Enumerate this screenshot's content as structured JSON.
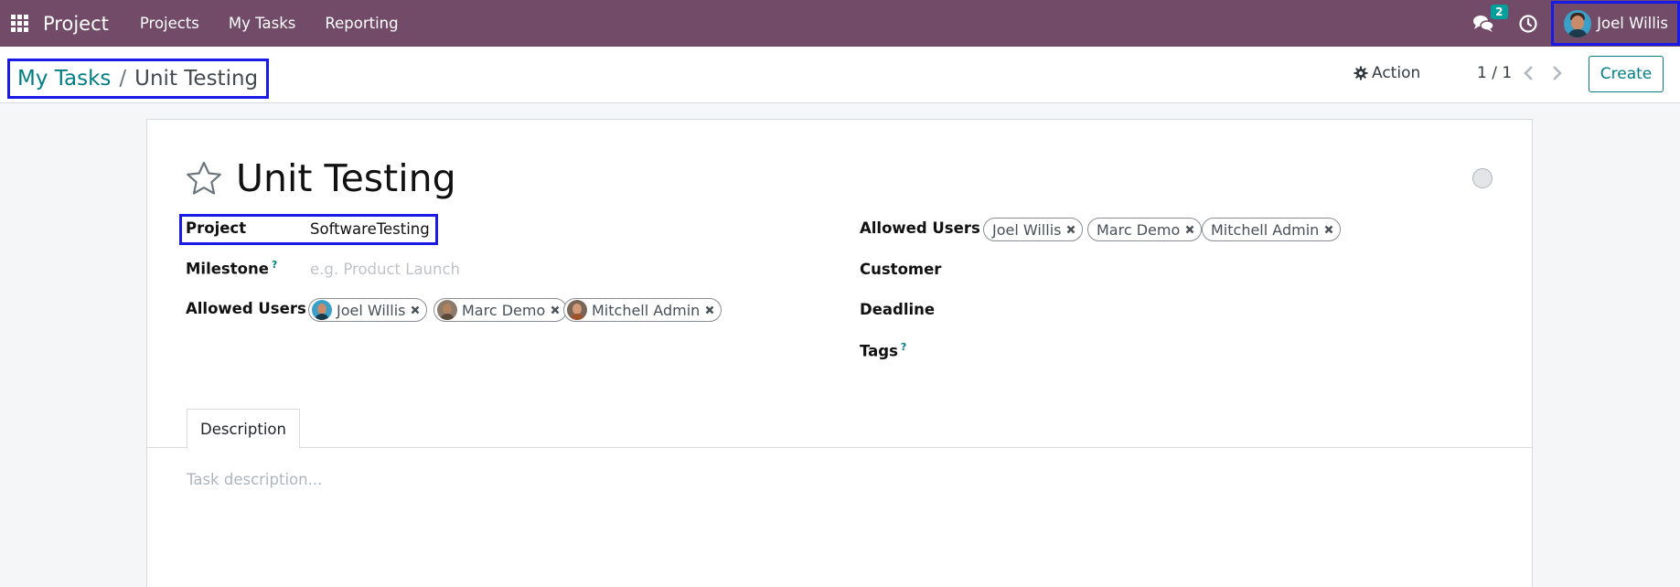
{
  "navbar": {
    "app_name": "Project",
    "menu": [
      "Projects",
      "My Tasks",
      "Reporting"
    ],
    "messages_badge": "2",
    "user_name": "Joel Willis",
    "bg_color": "#714b67"
  },
  "control_panel": {
    "breadcrumb_parent": "My Tasks",
    "breadcrumb_separator": "/",
    "breadcrumb_current": "Unit Testing",
    "action_label": "Action",
    "pager": "1 / 1",
    "create_label": "Create"
  },
  "form": {
    "title": "Unit Testing",
    "left": {
      "project_label": "Project",
      "project_value": "SoftwareTesting",
      "milestone_label": "Milestone",
      "milestone_help": "?",
      "milestone_placeholder": "e.g. Product Launch",
      "allowed_users_label": "Allowed Users",
      "allowed_users": [
        "Joel Willis",
        "Marc Demo",
        "Mitchell Admin"
      ]
    },
    "right": {
      "allowed_users_label": "Allowed Users",
      "allowed_users": [
        "Joel Willis",
        "Marc Demo",
        "Mitchell Admin"
      ],
      "customer_label": "Customer",
      "deadline_label": "Deadline",
      "tags_label": "Tags",
      "tags_help": "?"
    },
    "tabs": [
      "Description"
    ],
    "description_placeholder": "Task description..."
  },
  "colors": {
    "accent": "#017e84",
    "highlight_border": "#1a1ae6"
  }
}
